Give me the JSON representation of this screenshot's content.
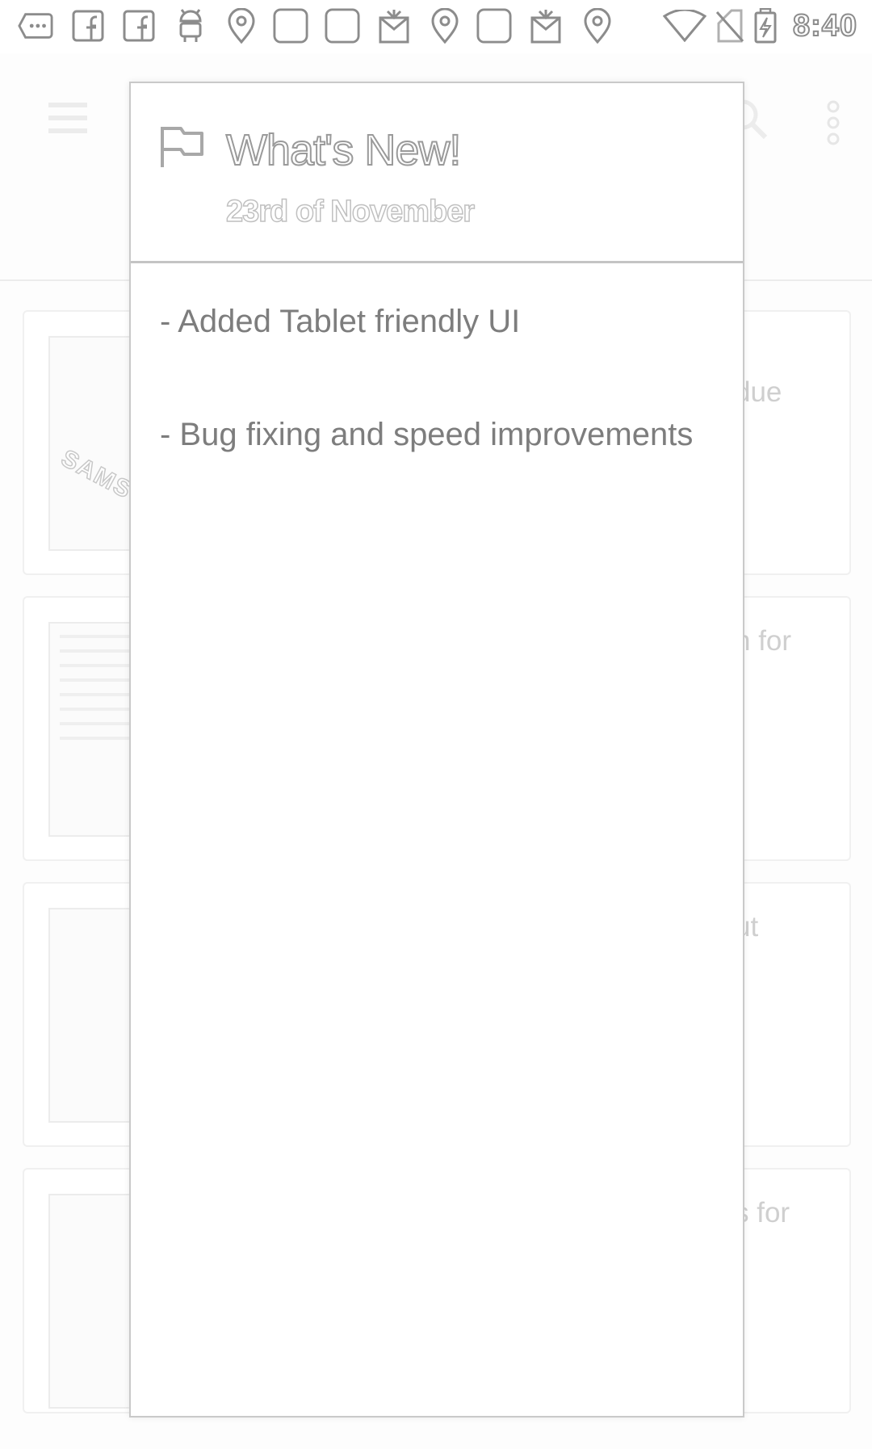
{
  "status_bar": {
    "time": "8:40",
    "left_icons": [
      "chat-bubble-icon",
      "facebook-icon",
      "facebook-icon",
      "android-notification-icon",
      "location-pin-icon",
      "blank-notification-icon",
      "blank-notification-icon",
      "gift-icon",
      "location-pin-icon",
      "blank-notification-icon",
      "gift-icon",
      "location-pin-icon"
    ],
    "right_icons": [
      "wifi-icon",
      "no-sim-icon",
      "battery-charging-icon"
    ]
  },
  "background": {
    "cards": [
      {
        "snippet": "due"
      },
      {
        "snippet": "n for"
      },
      {
        "snippet": "ut"
      },
      {
        "snippet": "s for"
      }
    ]
  },
  "dialog": {
    "icon": "flag-icon",
    "title": "What's New!",
    "date": "23rd of November",
    "items": [
      "- Added Tablet friendly UI",
      "- Bug fixing and speed improvements"
    ]
  },
  "colors": {
    "line": "#8c8c8c",
    "background": "#fdfdfd",
    "dialog_background": "#ffffff",
    "body_text": "#7d7d7d"
  }
}
